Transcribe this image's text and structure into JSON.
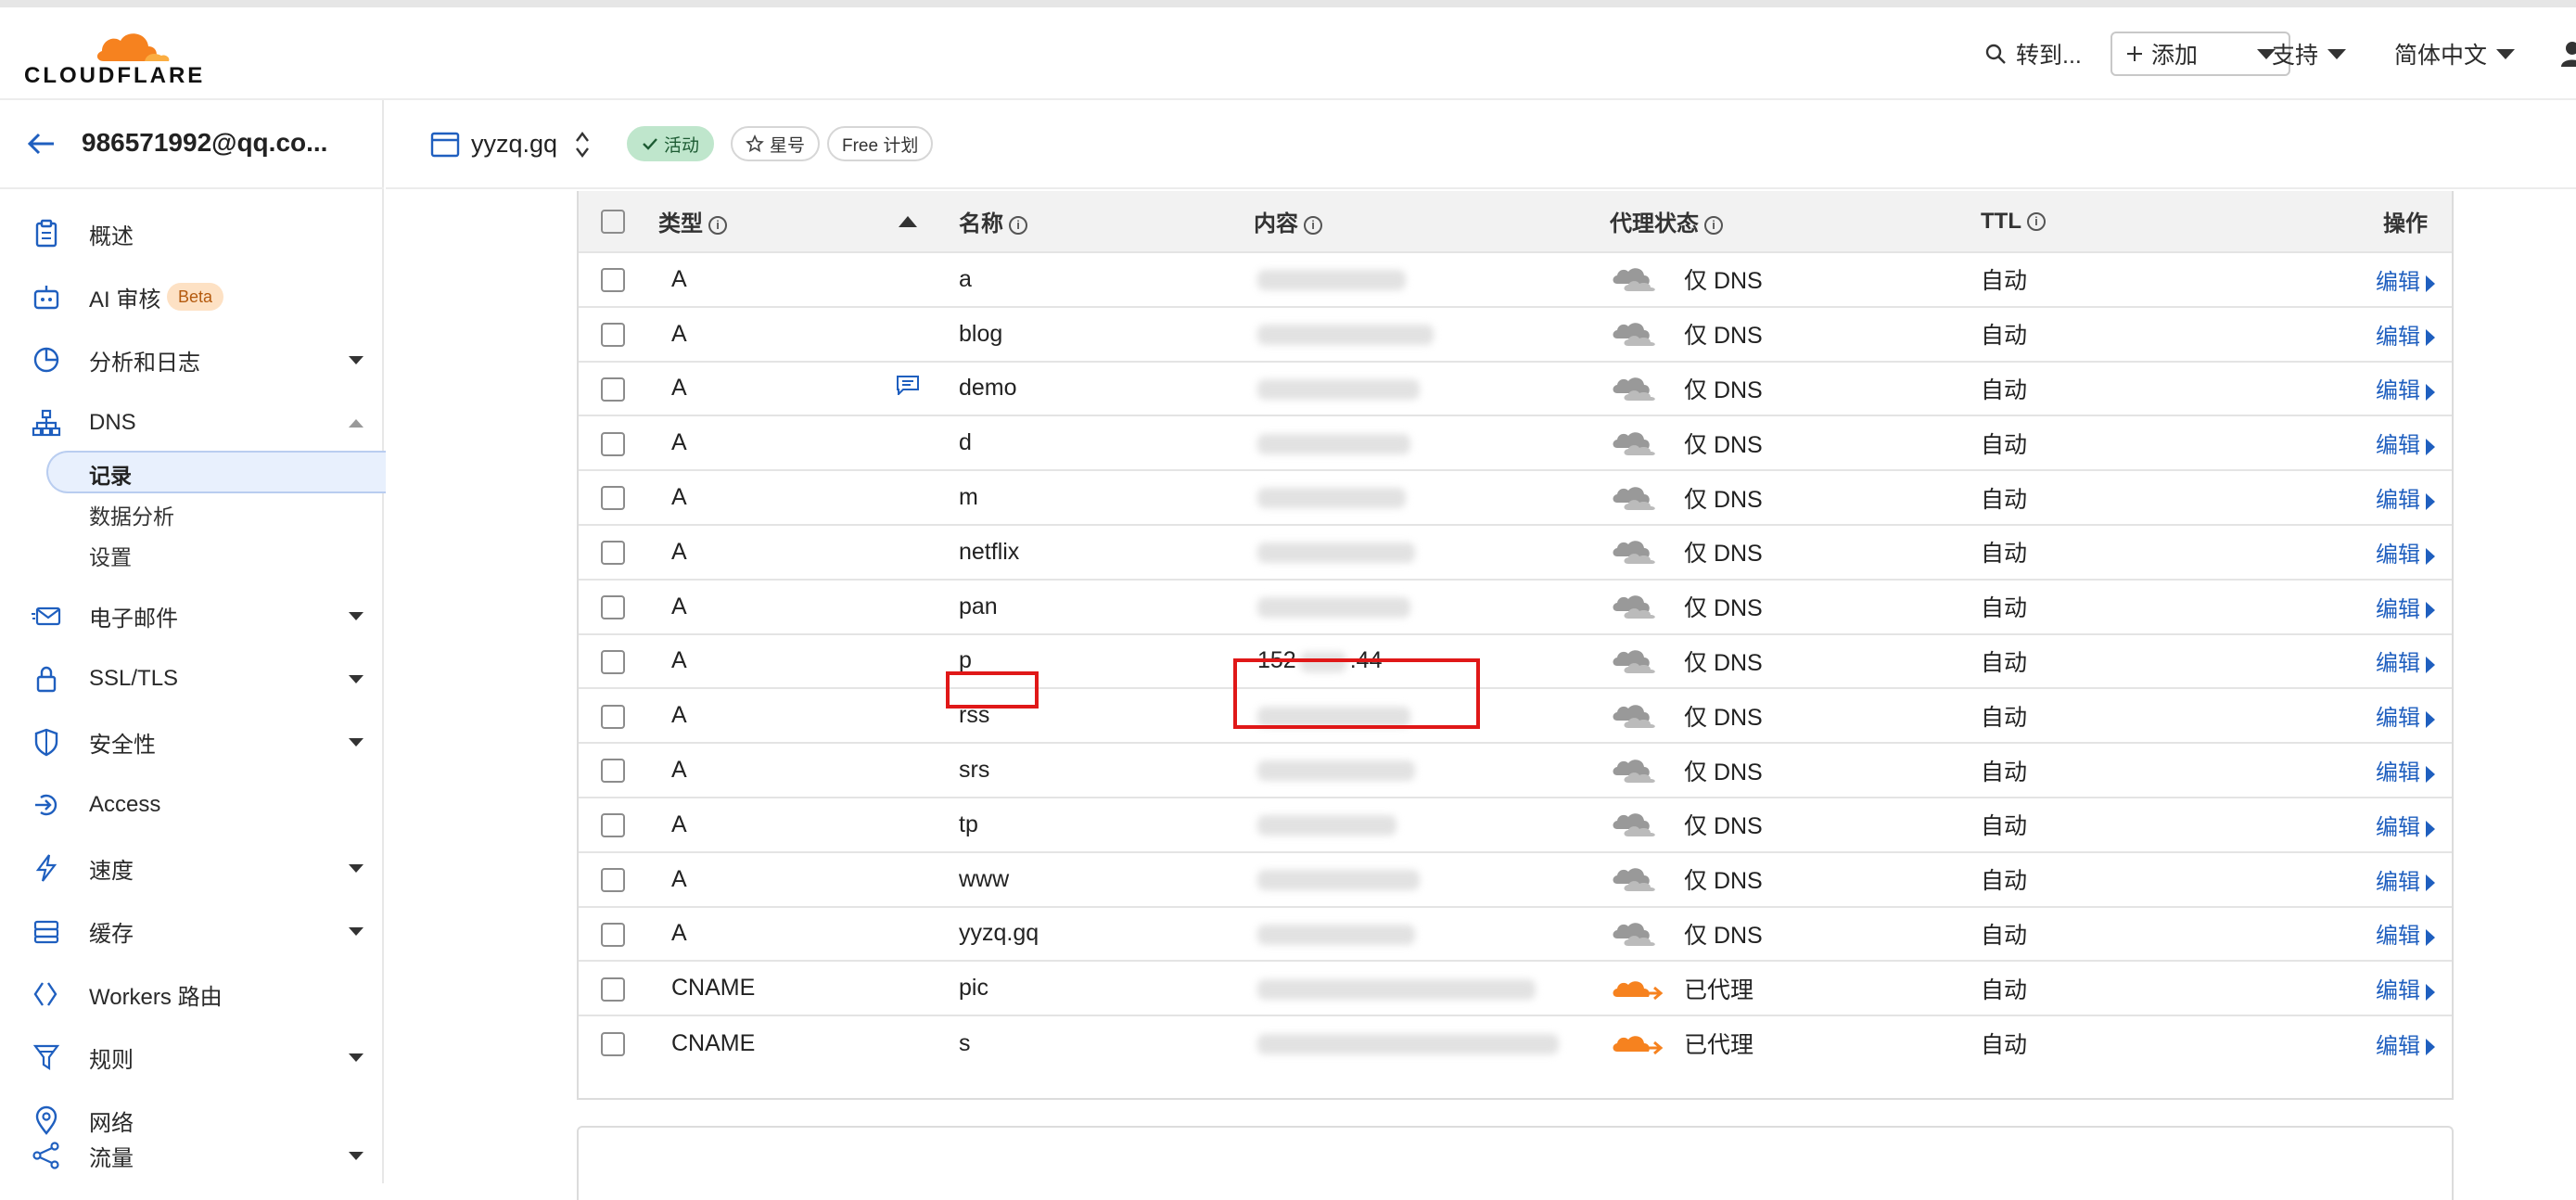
{
  "header": {
    "logo_text": "CLOUDFLARE",
    "search_label": "转到...",
    "add_label": "添加",
    "support_label": "支持",
    "lang_label": "简体中文"
  },
  "sidebar": {
    "account": "986571992@qq.co...",
    "items": [
      {
        "label": "概述"
      },
      {
        "label": "AI 审核",
        "badge": "Beta"
      },
      {
        "label": "分析和日志"
      },
      {
        "label": "DNS"
      },
      {
        "label": "电子邮件"
      },
      {
        "label": "SSL/TLS"
      },
      {
        "label": "安全性"
      },
      {
        "label": "Access"
      },
      {
        "label": "速度"
      },
      {
        "label": "缓存"
      },
      {
        "label": "Workers 路由"
      },
      {
        "label": "规则"
      },
      {
        "label": "网络"
      },
      {
        "label": "流量"
      }
    ],
    "dns_sub": [
      "记录",
      "数据分析",
      "设置"
    ]
  },
  "zone": {
    "name": "yyzq.gq",
    "status": "活动",
    "star": "星号",
    "plan": "Free 计划"
  },
  "table": {
    "headers": {
      "type": "类型",
      "name": "名称",
      "content": "内容",
      "proxy": "代理状态",
      "ttl": "TTL",
      "actions": "操作"
    },
    "rows": [
      {
        "type": "A",
        "name": "a",
        "content": "",
        "proxy": "仅 DNS",
        "ttl": "自动",
        "edit": "编辑"
      },
      {
        "type": "A",
        "name": "blog",
        "content": "",
        "proxy": "仅 DNS",
        "ttl": "自动",
        "edit": "编辑"
      },
      {
        "type": "A",
        "name": "demo",
        "content": "",
        "proxy": "仅 DNS",
        "ttl": "自动",
        "edit": "编辑"
      },
      {
        "type": "A",
        "name": "d",
        "content": "",
        "proxy": "仅 DNS",
        "ttl": "自动",
        "edit": "编辑"
      },
      {
        "type": "A",
        "name": "m",
        "content": "",
        "proxy": "仅 DNS",
        "ttl": "自动",
        "edit": "编辑"
      },
      {
        "type": "A",
        "name": "netflix",
        "content": "",
        "proxy": "仅 DNS",
        "ttl": "自动",
        "edit": "编辑"
      },
      {
        "type": "A",
        "name": "pan",
        "content": "",
        "proxy": "仅 DNS",
        "ttl": "自动",
        "edit": "编辑"
      },
      {
        "type": "A",
        "name": "p",
        "content": "152",
        "content_tail": ".44",
        "proxy": "仅 DNS",
        "ttl": "自动",
        "edit": "编辑"
      },
      {
        "type": "A",
        "name": "rss",
        "content": "",
        "proxy": "仅 DNS",
        "ttl": "自动",
        "edit": "编辑"
      },
      {
        "type": "A",
        "name": "srs",
        "content": "",
        "proxy": "仅 DNS",
        "ttl": "自动",
        "edit": "编辑"
      },
      {
        "type": "A",
        "name": "tp",
        "content": "",
        "proxy": "仅 DNS",
        "ttl": "自动",
        "edit": "编辑"
      },
      {
        "type": "A",
        "name": "www",
        "content": "",
        "proxy": "仅 DNS",
        "ttl": "自动",
        "edit": "编辑"
      },
      {
        "type": "A",
        "name": "yyzq.gq",
        "content": "",
        "proxy": "仅 DNS",
        "ttl": "自动",
        "edit": "编辑"
      },
      {
        "type": "CNAME",
        "name": "pic",
        "content": "",
        "proxy": "已代理",
        "ttl": "自动",
        "edit": "编辑"
      },
      {
        "type": "CNAME",
        "name": "s",
        "content": "",
        "proxy": "已代理",
        "ttl": "自动",
        "edit": "编辑"
      }
    ]
  },
  "colors": {
    "accent": "#f6821f",
    "link": "#1f5fbf",
    "highlight": "#e01818",
    "active_pill": "#bfe6cc"
  }
}
